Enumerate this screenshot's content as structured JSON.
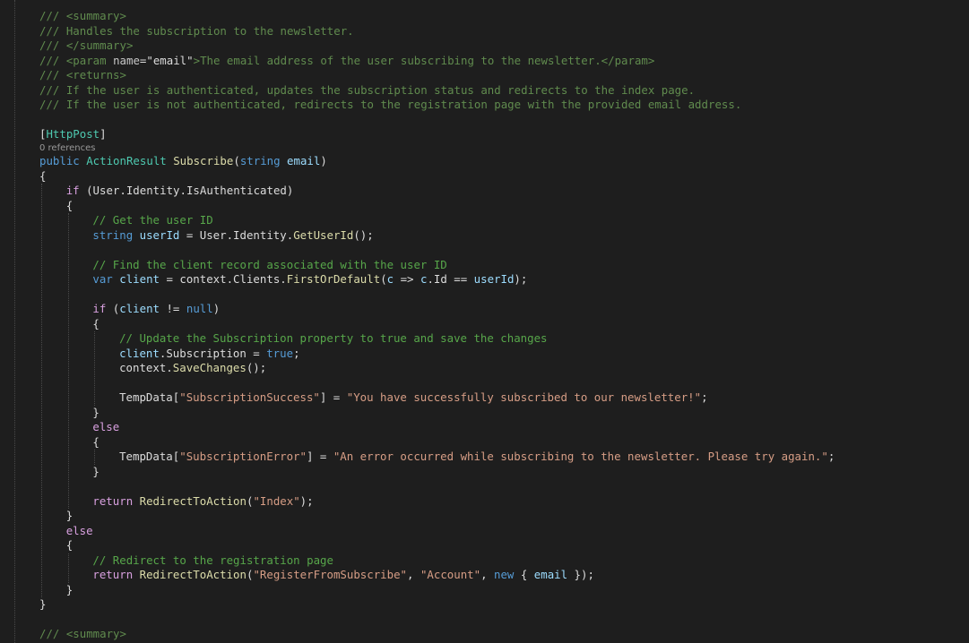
{
  "editor": {
    "theme": {
      "background": "#1e1e1e",
      "comment": "#57a64a",
      "keyword": "#569cd6",
      "control_keyword": "#d8a0df",
      "type": "#4ec9b0",
      "method": "#dcdcaa",
      "string": "#d69d85",
      "variable": "#9cdcfe",
      "plain": "#dcdcdc"
    },
    "lines": [
      {
        "kind": "code",
        "indent": 0,
        "tokens": [
          {
            "t": "/// ",
            "c": "doc"
          },
          {
            "t": "<summary>",
            "c": "tag"
          }
        ]
      },
      {
        "kind": "code",
        "indent": 0,
        "tokens": [
          {
            "t": "/// Handles the subscription to the newsletter.",
            "c": "doc"
          }
        ]
      },
      {
        "kind": "code",
        "indent": 0,
        "tokens": [
          {
            "t": "/// ",
            "c": "doc"
          },
          {
            "t": "</summary>",
            "c": "tag"
          }
        ]
      },
      {
        "kind": "code",
        "indent": 0,
        "tokens": [
          {
            "t": "/// ",
            "c": "doc"
          },
          {
            "t": "<param ",
            "c": "tag"
          },
          {
            "t": "name",
            "c": "attrname"
          },
          {
            "t": "=",
            "c": "plain"
          },
          {
            "t": "\"email\"",
            "c": "plain"
          },
          {
            "t": ">",
            "c": "tag"
          },
          {
            "t": "The email address of the user subscribing to the newsletter.",
            "c": "doc"
          },
          {
            "t": "</param>",
            "c": "tag"
          }
        ]
      },
      {
        "kind": "code",
        "indent": 0,
        "tokens": [
          {
            "t": "/// ",
            "c": "doc"
          },
          {
            "t": "<returns>",
            "c": "tag"
          }
        ]
      },
      {
        "kind": "code",
        "indent": 0,
        "tokens": [
          {
            "t": "/// If the user is authenticated, updates the subscription status and redirects to the index page.",
            "c": "doc"
          }
        ]
      },
      {
        "kind": "code",
        "indent": 0,
        "tokens": [
          {
            "t": "/// If the user is not authenticated, redirects to the registration page with the provided email address.",
            "c": "doc"
          }
        ]
      },
      {
        "kind": "code",
        "indent": 0,
        "tokens": []
      },
      {
        "kind": "code",
        "indent": 0,
        "tokens": [
          {
            "t": "[",
            "c": "plain"
          },
          {
            "t": "HttpPost",
            "c": "type"
          },
          {
            "t": "]",
            "c": "plain"
          }
        ]
      },
      {
        "kind": "lens",
        "indent": 0,
        "text": "0 references"
      },
      {
        "kind": "code",
        "indent": 0,
        "tokens": [
          {
            "t": "public ",
            "c": "kw"
          },
          {
            "t": "ActionResult ",
            "c": "type"
          },
          {
            "t": "Subscribe",
            "c": "method"
          },
          {
            "t": "(",
            "c": "plain"
          },
          {
            "t": "string ",
            "c": "kw"
          },
          {
            "t": "email",
            "c": "var"
          },
          {
            "t": ")",
            "c": "plain"
          }
        ]
      },
      {
        "kind": "code",
        "indent": 0,
        "tokens": [
          {
            "t": "{",
            "c": "plain"
          }
        ]
      },
      {
        "kind": "code",
        "indent": 1,
        "tokens": [
          {
            "t": "if ",
            "c": "ctl"
          },
          {
            "t": "(User.Identity.IsAuthenticated)",
            "c": "plain"
          }
        ]
      },
      {
        "kind": "code",
        "indent": 1,
        "tokens": [
          {
            "t": "{",
            "c": "plain"
          }
        ]
      },
      {
        "kind": "code",
        "indent": 2,
        "tokens": [
          {
            "t": "// Get the user ID",
            "c": "comment"
          }
        ]
      },
      {
        "kind": "code",
        "indent": 2,
        "tokens": [
          {
            "t": "string ",
            "c": "kw"
          },
          {
            "t": "userId",
            "c": "var"
          },
          {
            "t": " = User.Identity.",
            "c": "plain"
          },
          {
            "t": "GetUserId",
            "c": "method"
          },
          {
            "t": "();",
            "c": "plain"
          }
        ]
      },
      {
        "kind": "code",
        "indent": 2,
        "tokens": []
      },
      {
        "kind": "code",
        "indent": 2,
        "tokens": [
          {
            "t": "// Find the client record associated with the user ID",
            "c": "comment"
          }
        ]
      },
      {
        "kind": "code",
        "indent": 2,
        "tokens": [
          {
            "t": "var ",
            "c": "kw"
          },
          {
            "t": "client",
            "c": "var"
          },
          {
            "t": " = context.Clients.",
            "c": "plain"
          },
          {
            "t": "FirstOrDefault",
            "c": "method"
          },
          {
            "t": "(",
            "c": "plain"
          },
          {
            "t": "c",
            "c": "var"
          },
          {
            "t": " => ",
            "c": "plain"
          },
          {
            "t": "c",
            "c": "var"
          },
          {
            "t": ".Id == ",
            "c": "plain"
          },
          {
            "t": "userId",
            "c": "var"
          },
          {
            "t": ");",
            "c": "plain"
          }
        ]
      },
      {
        "kind": "code",
        "indent": 2,
        "tokens": []
      },
      {
        "kind": "code",
        "indent": 2,
        "tokens": [
          {
            "t": "if ",
            "c": "ctl"
          },
          {
            "t": "(",
            "c": "plain"
          },
          {
            "t": "client",
            "c": "var"
          },
          {
            "t": " != ",
            "c": "plain"
          },
          {
            "t": "null",
            "c": "kw"
          },
          {
            "t": ")",
            "c": "plain"
          }
        ]
      },
      {
        "kind": "code",
        "indent": 2,
        "tokens": [
          {
            "t": "{",
            "c": "plain"
          }
        ]
      },
      {
        "kind": "code",
        "indent": 3,
        "tokens": [
          {
            "t": "// Update the Subscription property to true and save the changes",
            "c": "comment"
          }
        ]
      },
      {
        "kind": "code",
        "indent": 3,
        "tokens": [
          {
            "t": "client",
            "c": "var"
          },
          {
            "t": ".Subscription = ",
            "c": "plain"
          },
          {
            "t": "true",
            "c": "kw"
          },
          {
            "t": ";",
            "c": "plain"
          }
        ]
      },
      {
        "kind": "code",
        "indent": 3,
        "tokens": [
          {
            "t": "context.",
            "c": "plain"
          },
          {
            "t": "SaveChanges",
            "c": "method"
          },
          {
            "t": "();",
            "c": "plain"
          }
        ]
      },
      {
        "kind": "code",
        "indent": 3,
        "tokens": []
      },
      {
        "kind": "code",
        "indent": 3,
        "tokens": [
          {
            "t": "TempData[",
            "c": "plain"
          },
          {
            "t": "\"SubscriptionSuccess\"",
            "c": "str"
          },
          {
            "t": "] = ",
            "c": "plain"
          },
          {
            "t": "\"You have successfully subscribed to our newsletter!\"",
            "c": "str"
          },
          {
            "t": ";",
            "c": "plain"
          }
        ]
      },
      {
        "kind": "code",
        "indent": 2,
        "tokens": [
          {
            "t": "}",
            "c": "plain"
          }
        ]
      },
      {
        "kind": "code",
        "indent": 2,
        "tokens": [
          {
            "t": "else",
            "c": "ctl"
          }
        ]
      },
      {
        "kind": "code",
        "indent": 2,
        "tokens": [
          {
            "t": "{",
            "c": "plain"
          }
        ]
      },
      {
        "kind": "code",
        "indent": 3,
        "tokens": [
          {
            "t": "TempData[",
            "c": "plain"
          },
          {
            "t": "\"SubscriptionError\"",
            "c": "str"
          },
          {
            "t": "] = ",
            "c": "plain"
          },
          {
            "t": "\"An error occurred while subscribing to the newsletter. Please try again.\"",
            "c": "str"
          },
          {
            "t": ";",
            "c": "plain"
          }
        ]
      },
      {
        "kind": "code",
        "indent": 2,
        "tokens": [
          {
            "t": "}",
            "c": "plain"
          }
        ]
      },
      {
        "kind": "code",
        "indent": 2,
        "tokens": []
      },
      {
        "kind": "code",
        "indent": 2,
        "tokens": [
          {
            "t": "return ",
            "c": "ctl"
          },
          {
            "t": "RedirectToAction",
            "c": "method"
          },
          {
            "t": "(",
            "c": "plain"
          },
          {
            "t": "\"Index\"",
            "c": "str"
          },
          {
            "t": ");",
            "c": "plain"
          }
        ]
      },
      {
        "kind": "code",
        "indent": 1,
        "tokens": [
          {
            "t": "}",
            "c": "plain"
          }
        ]
      },
      {
        "kind": "code",
        "indent": 1,
        "tokens": [
          {
            "t": "else",
            "c": "ctl"
          }
        ]
      },
      {
        "kind": "code",
        "indent": 1,
        "tokens": [
          {
            "t": "{",
            "c": "plain"
          }
        ]
      },
      {
        "kind": "code",
        "indent": 2,
        "tokens": [
          {
            "t": "// Redirect to the registration page",
            "c": "comment"
          }
        ]
      },
      {
        "kind": "code",
        "indent": 2,
        "tokens": [
          {
            "t": "return ",
            "c": "ctl"
          },
          {
            "t": "RedirectToAction",
            "c": "method"
          },
          {
            "t": "(",
            "c": "plain"
          },
          {
            "t": "\"RegisterFromSubscribe\"",
            "c": "str"
          },
          {
            "t": ", ",
            "c": "plain"
          },
          {
            "t": "\"Account\"",
            "c": "str"
          },
          {
            "t": ", ",
            "c": "plain"
          },
          {
            "t": "new",
            "c": "kw"
          },
          {
            "t": " { ",
            "c": "plain"
          },
          {
            "t": "email",
            "c": "var"
          },
          {
            "t": " });",
            "c": "plain"
          }
        ]
      },
      {
        "kind": "code",
        "indent": 1,
        "tokens": [
          {
            "t": "}",
            "c": "plain"
          }
        ]
      },
      {
        "kind": "code",
        "indent": 0,
        "tokens": [
          {
            "t": "}",
            "c": "plain"
          }
        ]
      },
      {
        "kind": "code",
        "indent": 0,
        "tokens": []
      },
      {
        "kind": "code",
        "indent": 0,
        "tokens": [
          {
            "t": "/// ",
            "c": "doc"
          },
          {
            "t": "<summary>",
            "c": "tag"
          }
        ]
      }
    ]
  }
}
